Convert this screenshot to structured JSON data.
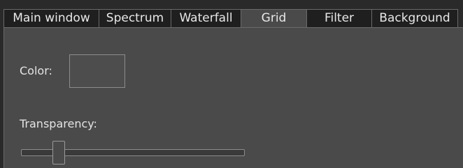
{
  "tabs": [
    {
      "label": "Main window",
      "active": false
    },
    {
      "label": "Spectrum",
      "active": false
    },
    {
      "label": "Waterfall",
      "active": false
    },
    {
      "label": "Grid",
      "active": true
    },
    {
      "label": "Filter",
      "active": false
    },
    {
      "label": "Background",
      "active": false
    }
  ],
  "grid_settings": {
    "color_label": "Color:",
    "color_value": "#4d4d4d",
    "transparency_label": "Transparency:",
    "transparency_value": 0.15
  },
  "colors": {
    "background": "#2a2a2a",
    "panel": "#4a4a4a",
    "tab_inactive": "#1f1f1f",
    "text": "#e4e4e4",
    "border": "#6a6a6a"
  }
}
